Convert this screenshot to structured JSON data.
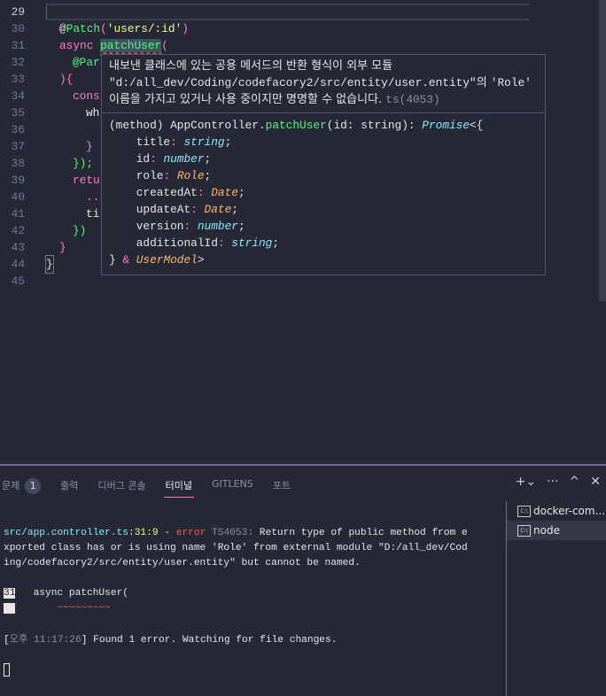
{
  "editor": {
    "line_numbers": [
      "29",
      "30",
      "31",
      "32",
      "33",
      "34",
      "35",
      "36",
      "37",
      "38",
      "39",
      "40",
      "41",
      "42",
      "43",
      "44",
      "45"
    ],
    "lines": {
      "l30_at": "@",
      "l30_dec": "Patch",
      "l30_p1": "(",
      "l30_str": "'users/:id'",
      "l30_p2": ")",
      "l31_kw": "async",
      "l31_fn": "patchUser",
      "l31_p": "(",
      "l32": "@Par",
      "l33": "){",
      "l34": "cons",
      "l35": "wh",
      "l37": "}",
      "l38": "});",
      "l39": "retu",
      "l40": "..",
      "l41": "ti",
      "l42": "})",
      "l43": "}",
      "l44": "}"
    }
  },
  "tooltip": {
    "message_1": "내보낸 클래스에 있는 공용 메서드의 반환 형식이 외부 모듈",
    "message_2a": "\"d:/all_dev/Coding/codefacory2/src/entity/user.entity\"",
    "message_2b": "의 ",
    "message_2c": "'Role'",
    "message_3": "이름을 가지고 있거나 사용 중이지만 명명할 수 없습니다.",
    "code": "ts(4053)",
    "sig_prefix": "(method) AppController.",
    "sig_fn": "patchUser",
    "sig_args": "(id: string): ",
    "sig_promise": "Promise",
    "sig_open": "<{",
    "fields": [
      {
        "name": "title",
        "type": "string",
        "kind": "primitive"
      },
      {
        "name": "id",
        "type": "number",
        "kind": "primitive"
      },
      {
        "name": "role",
        "type": "Role",
        "kind": "class"
      },
      {
        "name": "createdAt",
        "type": "Date",
        "kind": "class"
      },
      {
        "name": "updateAt",
        "type": "Date",
        "kind": "class"
      },
      {
        "name": "version",
        "type": "number",
        "kind": "primitive"
      },
      {
        "name": "additionalId",
        "type": "string",
        "kind": "primitive"
      }
    ],
    "sig_close": "} ",
    "sig_amp": "&",
    "sig_model": "UserModel",
    "sig_end": ">"
  },
  "panel": {
    "tabs": [
      {
        "label": "문제",
        "badge": "1"
      },
      {
        "label": "출력"
      },
      {
        "label": "디버그 콘솔"
      },
      {
        "label": "터미널",
        "active": true
      },
      {
        "label": "GITLENS"
      },
      {
        "label": "포트"
      }
    ],
    "terminal": {
      "err_file": "src/app.controller.ts",
      "err_colon": ":",
      "err_line": "31",
      "err_col": ":9",
      "err_dash": " - ",
      "err_word": "error",
      "err_code": " TS4053:",
      "err_msg_1": " Return type of public method from e",
      "err_msg_2": "xported class has or is using name 'Role' from external module \"D:/all_dev/Cod",
      "err_msg_3": "ing/codefacory2/src/entity/user.entity\" but cannot be named.",
      "src_line_no": "31",
      "src_line": "   async patchUser(",
      "src_squiggle": "~~~~~~~~~",
      "ts_open": "[",
      "ts_ampm": "오후",
      "ts_time": " 11:17:26",
      "ts_close": "]",
      "found": " Found 1 error. Watching for file changes."
    },
    "terminals": [
      {
        "label": "docker-com...",
        "icon": "terminal-cmd-icon"
      },
      {
        "label": "node",
        "icon": "terminal-cmd-icon",
        "selected": true
      }
    ]
  }
}
